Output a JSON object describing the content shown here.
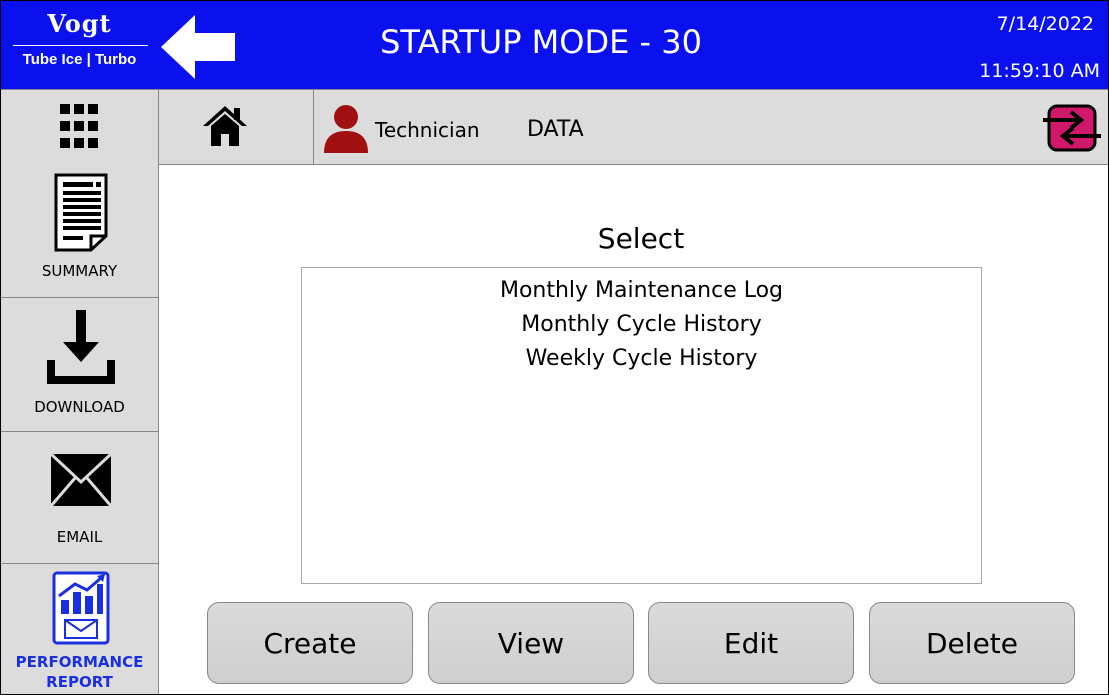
{
  "header": {
    "logo_brand": "Vogt",
    "logo_sub": "Tube Ice | Turbo",
    "title": "STARTUP MODE - 30",
    "date": "7/14/2022",
    "time": "11:59:10 AM"
  },
  "toolbar": {
    "user_role": "Technician",
    "section": "DATA"
  },
  "sidebar": {
    "items": [
      {
        "label": "SUMMARY",
        "icon": "document-icon"
      },
      {
        "label": "DOWNLOAD",
        "icon": "download-icon"
      },
      {
        "label": "EMAIL",
        "icon": "envelope-icon"
      },
      {
        "label_line1": "PERFORMANCE",
        "label_line2": "REPORT",
        "icon": "performance-report-icon"
      }
    ]
  },
  "main": {
    "select_title": "Select",
    "list_items": [
      "Monthly Maintenance Log",
      "Monthly Cycle History",
      "Weekly Cycle History"
    ],
    "buttons": {
      "create": "Create",
      "view": "View",
      "edit": "Edit",
      "delete": "Delete"
    }
  },
  "colors": {
    "header_bg": "#0a10ee",
    "panel_bg": "#dcdcdc",
    "user_icon": "#a01010",
    "switch_icon": "#d0186a",
    "performance_label": "#1a2fe0"
  }
}
